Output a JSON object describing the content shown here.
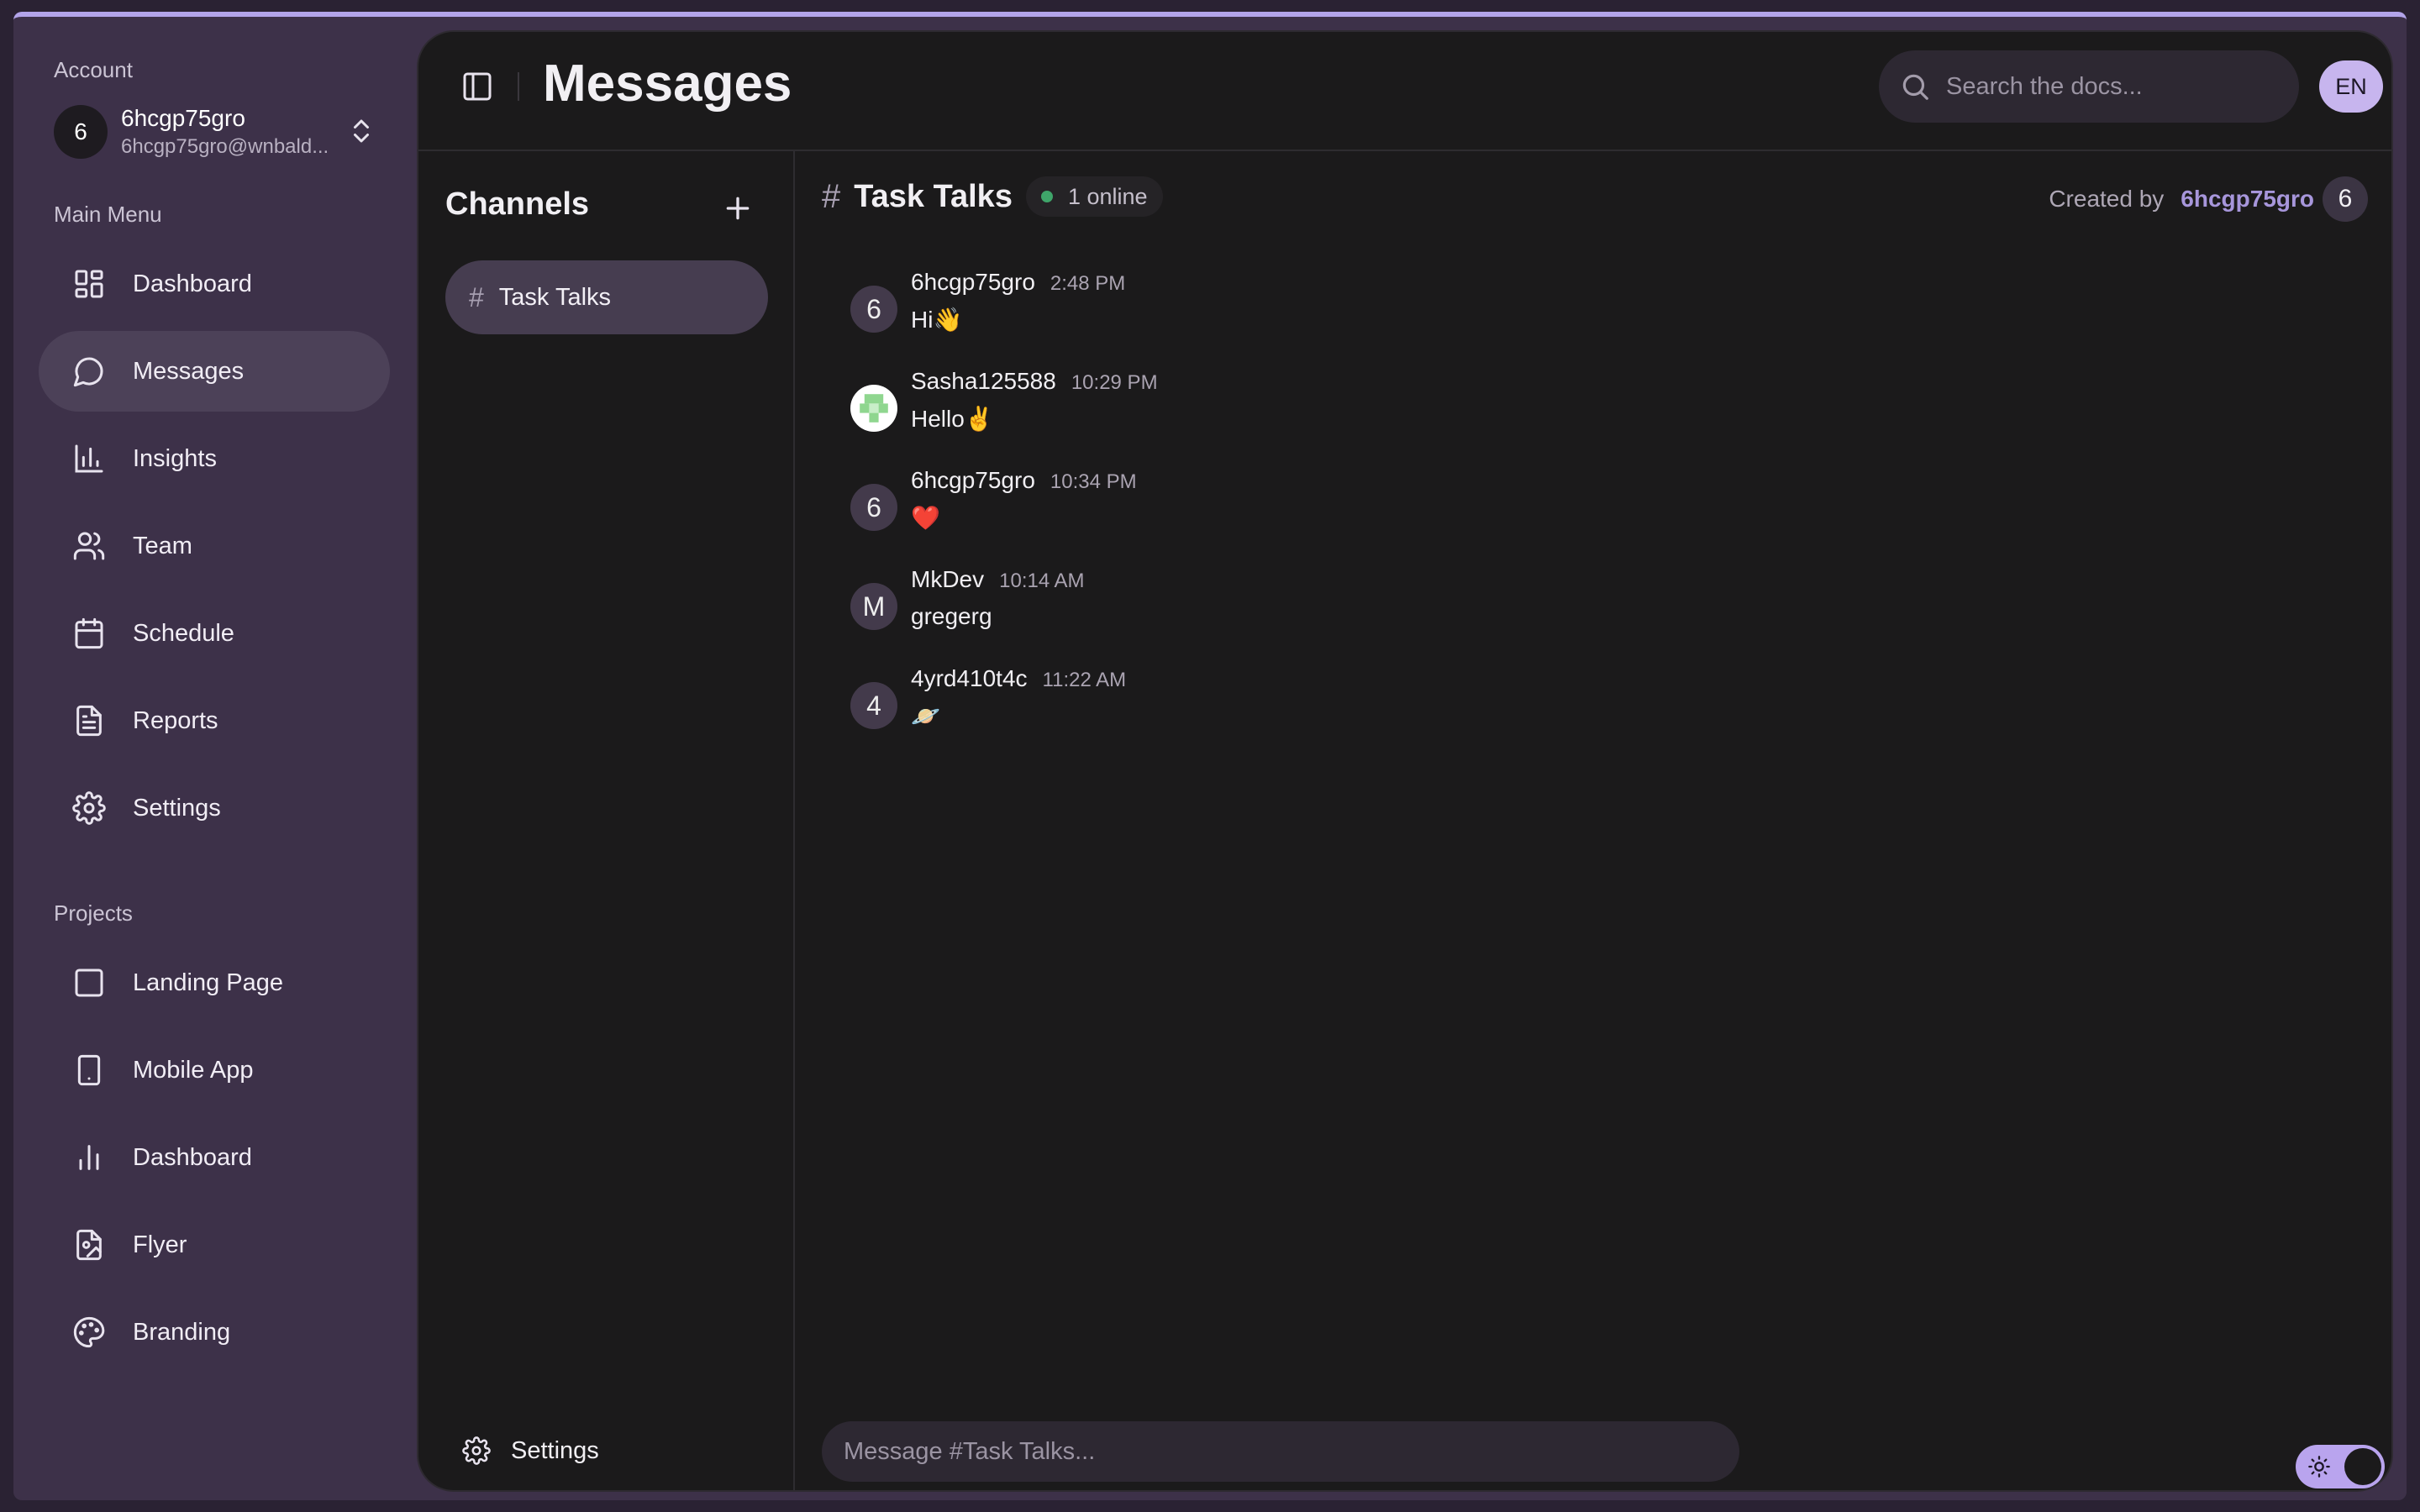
{
  "sidebar": {
    "account_label": "Account",
    "account": {
      "avatar": "6",
      "name": "6hcgp75gro",
      "email": "6hcgp75gro@wnbald..."
    },
    "main_menu_label": "Main Menu",
    "main_menu": [
      {
        "label": "Dashboard",
        "icon": "dashboard-icon",
        "active": false
      },
      {
        "label": "Messages",
        "icon": "message-icon",
        "active": true
      },
      {
        "label": "Insights",
        "icon": "bar-chart-icon",
        "active": false
      },
      {
        "label": "Team",
        "icon": "users-icon",
        "active": false
      },
      {
        "label": "Schedule",
        "icon": "calendar-icon",
        "active": false
      },
      {
        "label": "Reports",
        "icon": "document-icon",
        "active": false
      },
      {
        "label": "Settings",
        "icon": "gear-icon",
        "active": false
      }
    ],
    "projects_label": "Projects",
    "projects": [
      {
        "label": "Landing Page",
        "icon": "square-icon"
      },
      {
        "label": "Mobile App",
        "icon": "phone-icon"
      },
      {
        "label": "Dashboard",
        "icon": "chart-icon"
      },
      {
        "label": "Flyer",
        "icon": "file-image-icon"
      },
      {
        "label": "Branding",
        "icon": "palette-icon"
      }
    ]
  },
  "header": {
    "title": "Messages",
    "search_placeholder": "Search the docs...",
    "language": "EN"
  },
  "channels": {
    "title": "Channels",
    "items": [
      {
        "hash": "#",
        "label": "Task Talks"
      }
    ],
    "settings_label": "Settings"
  },
  "chat": {
    "hash": "#",
    "channel_name": "Task Talks",
    "online": "1 online",
    "created_by_label": "Created by",
    "created_by_user": "6hcgp75gro",
    "created_by_avatar": "6",
    "messages": [
      {
        "avatar": "6",
        "user": "6hcgp75gro",
        "time": "2:48 PM",
        "text": "Hi👋"
      },
      {
        "avatar": "",
        "user": "Sasha125588",
        "time": "10:29 PM",
        "text": "Hello✌️"
      },
      {
        "avatar": "6",
        "user": "6hcgp75gro",
        "time": "10:34 PM",
        "text": "❤️"
      },
      {
        "avatar": "M",
        "user": "MkDev",
        "time": "10:14 AM",
        "text": "gregerg"
      },
      {
        "avatar": "4",
        "user": "4yrd410t4c",
        "time": "11:22 AM",
        "text": "🪐"
      }
    ],
    "composer_placeholder": "Message #Task Talks..."
  },
  "colors": {
    "accent": "#b9a4ee",
    "sidebar_bg": "#3d3149",
    "main_bg": "#1b1a1b",
    "online_dot": "#3fa56a"
  }
}
